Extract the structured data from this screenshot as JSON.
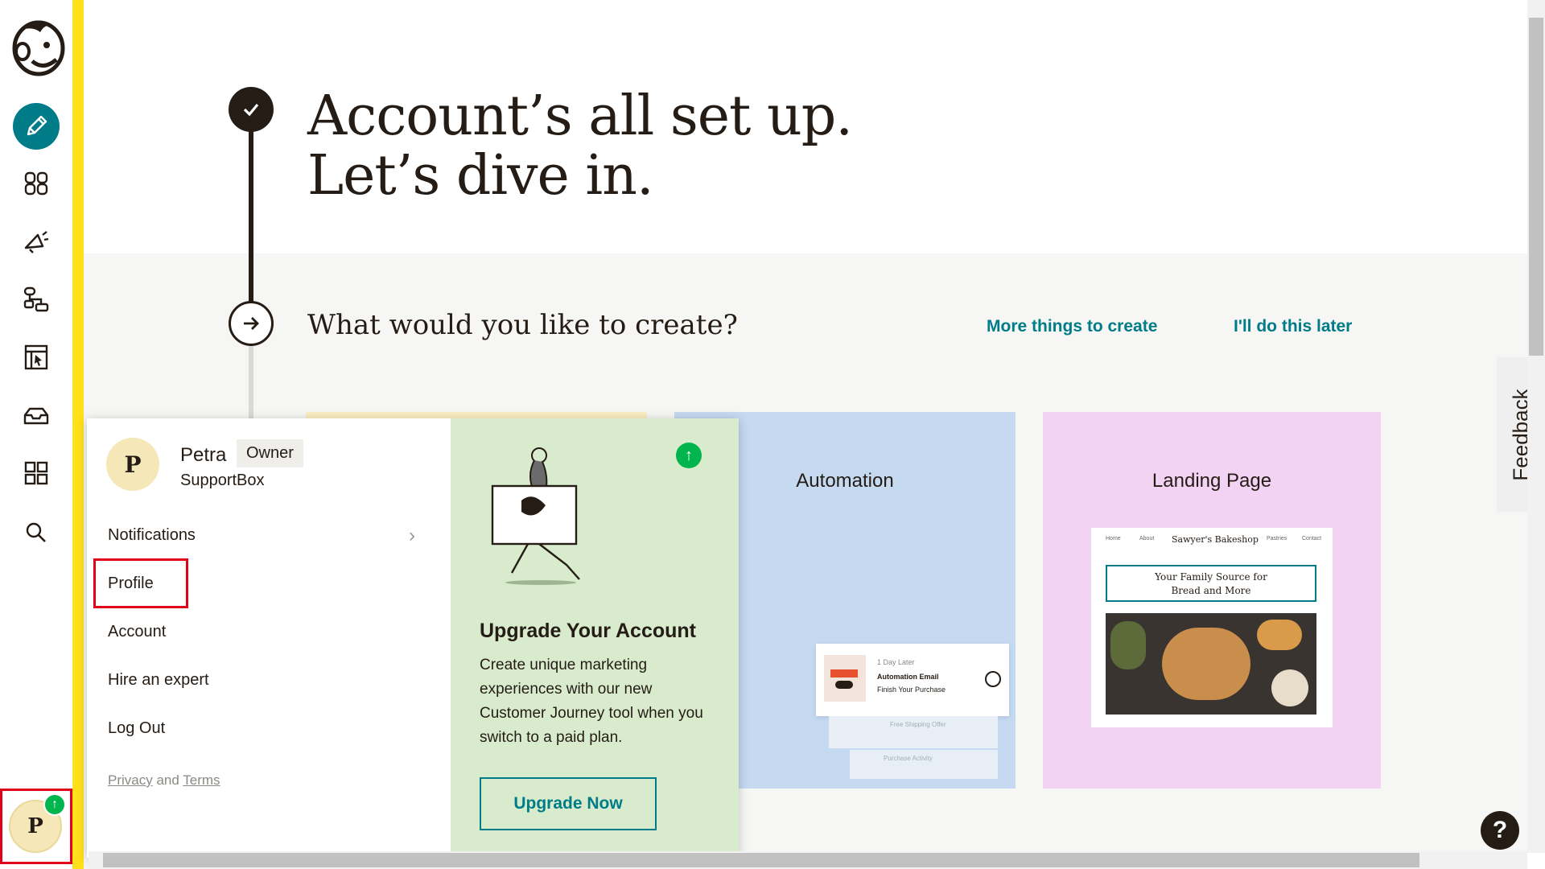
{
  "sidebar": {
    "logo": "mailchimp-freddie-logo",
    "items": [
      {
        "name": "create",
        "icon": "pencil-icon"
      },
      {
        "name": "audience",
        "icon": "people-icon"
      },
      {
        "name": "campaigns",
        "icon": "megaphone-icon"
      },
      {
        "name": "automations",
        "icon": "flow-icon"
      },
      {
        "name": "website",
        "icon": "page-cursor-icon"
      },
      {
        "name": "content-studio",
        "icon": "inbox-icon"
      },
      {
        "name": "integrations",
        "icon": "grid-icon"
      },
      {
        "name": "search",
        "icon": "search-icon"
      }
    ],
    "avatar_initial": "P",
    "accent": "#ffe01b",
    "create_color": "#007c89"
  },
  "main": {
    "headline_line1": "Account’s all set up.",
    "headline_line2": "Let’s dive in.",
    "question": "What would you like to create?",
    "link_more": "More things to create",
    "link_later": "I'll do this later",
    "cards": [
      {
        "title": "Automation",
        "color": "#c5d9f1"
      },
      {
        "title": "Landing Page",
        "color": "#f3d3f3"
      }
    ],
    "automation_preview": {
      "delay": "1 Day Later",
      "email_title": "Automation Email",
      "email_sub": "Finish Your Purchase",
      "second": "Free Shipping Offer",
      "third": "Purchase Activity"
    },
    "landing_preview": {
      "shop_name": "Sawyer's Bakeshop",
      "nav": [
        "Home",
        "About",
        "Pastries",
        "Contact"
      ],
      "headline_line1": "Your Family Source for",
      "headline_line2": "Bread and More"
    }
  },
  "menu": {
    "avatar_initial": "P",
    "user_name": "Petra",
    "role": "Owner",
    "org": "SupportBox",
    "items": {
      "notifications": "Notifications",
      "profile": "Profile",
      "account": "Account",
      "hire": "Hire an expert",
      "logout": "Log Out"
    },
    "privacy": "Privacy",
    "and": "and",
    "terms": "Terms",
    "upgrade": {
      "title": "Upgrade Your Account",
      "body": "Create unique marketing experiences with our new Customer Journey tool when you switch to a paid plan.",
      "button": "Upgrade Now"
    }
  },
  "feedback": "Feedback",
  "help": "?"
}
